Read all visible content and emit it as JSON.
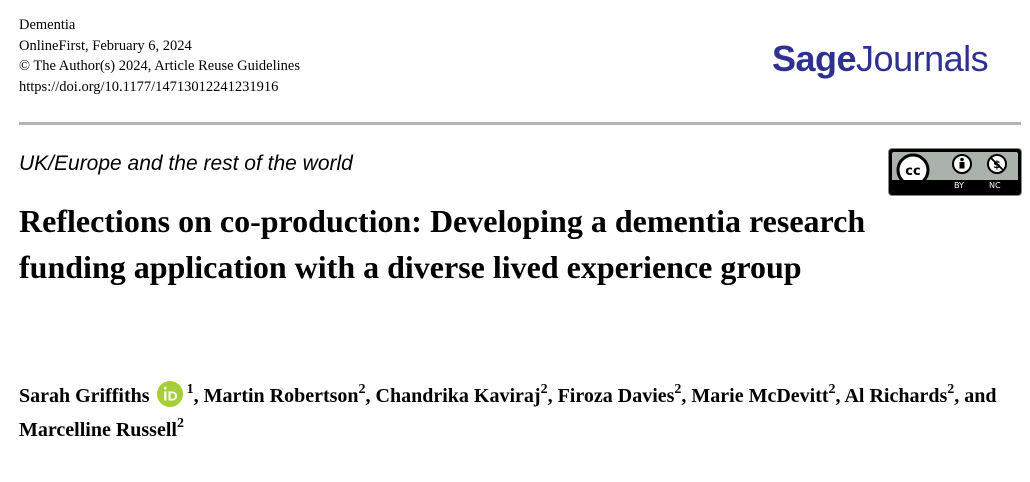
{
  "meta": {
    "journal": "Dementia",
    "published": "OnlineFirst, February 6, 2024",
    "copyright": "© The Author(s) 2024, Article Reuse Guidelines",
    "doi": "https://doi.org/10.1177/14713012241231916"
  },
  "logo": {
    "part1": "Sage",
    "part2": "Journals",
    "color": "#2e3092"
  },
  "section": "UK/Europe and the rest of the world",
  "license": {
    "by_label": "BY",
    "nc_label": "NC"
  },
  "title": "Reflections on co-production: Developing a dementia research funding application with a diverse lived experience group",
  "authors": [
    {
      "name": "Sarah Griffiths",
      "aff": "1",
      "sep": ", ",
      "orcid": true
    },
    {
      "name": "Martin Robertson",
      "aff": "2",
      "sep": ", "
    },
    {
      "name": "Chandrika Kaviraj",
      "aff": "2",
      "sep": ", "
    },
    {
      "name": "Firoza Davies",
      "aff": "2",
      "sep": ", "
    },
    {
      "name": "Marie McDevitt",
      "aff": "2",
      "sep": ", "
    },
    {
      "name": "Al Richards",
      "aff": "2",
      "sep": ", and "
    },
    {
      "name": "Marcelline Russell",
      "aff": "2",
      "sep": ""
    }
  ]
}
